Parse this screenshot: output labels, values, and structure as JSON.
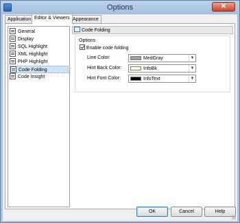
{
  "window": {
    "title": "Options",
    "close_glyph": "✕"
  },
  "tabs": [
    {
      "label": "Application",
      "active": false
    },
    {
      "label": "Editor & Viewers",
      "active": true
    },
    {
      "label": "Appearance",
      "active": false
    }
  ],
  "tree": {
    "items": [
      {
        "label": "General",
        "icon": "settings-page-icon"
      },
      {
        "label": "Display",
        "icon": "display-page-icon"
      },
      {
        "label": "SQL Highlight",
        "icon": "highlight-page-icon"
      },
      {
        "label": "XML Highlight",
        "icon": "highlight-page-icon"
      },
      {
        "label": "PHP Highlight",
        "icon": "highlight-page-icon"
      },
      {
        "label": "Code Folding",
        "icon": "folding-page-icon",
        "selected": true
      },
      {
        "label": "Code Insight",
        "icon": "insight-page-icon"
      }
    ]
  },
  "page": {
    "header": "Code Folding",
    "group_label": "Options",
    "enable_label": "Enable code folding",
    "enable_checked": true,
    "fields": [
      {
        "label": "Line Color:",
        "value": "MedGray",
        "swatch": "#a0a0a4"
      },
      {
        "label": "Hint Back Color:",
        "value": "InfoBk",
        "swatch": "#ffffe1"
      },
      {
        "label": "Hint Font Color:",
        "value": "InfoText",
        "swatch": "#000000"
      }
    ],
    "dropdown_glyph": "▼"
  },
  "buttons": {
    "ok": "OK",
    "cancel": "Cancel",
    "help": "Help"
  }
}
